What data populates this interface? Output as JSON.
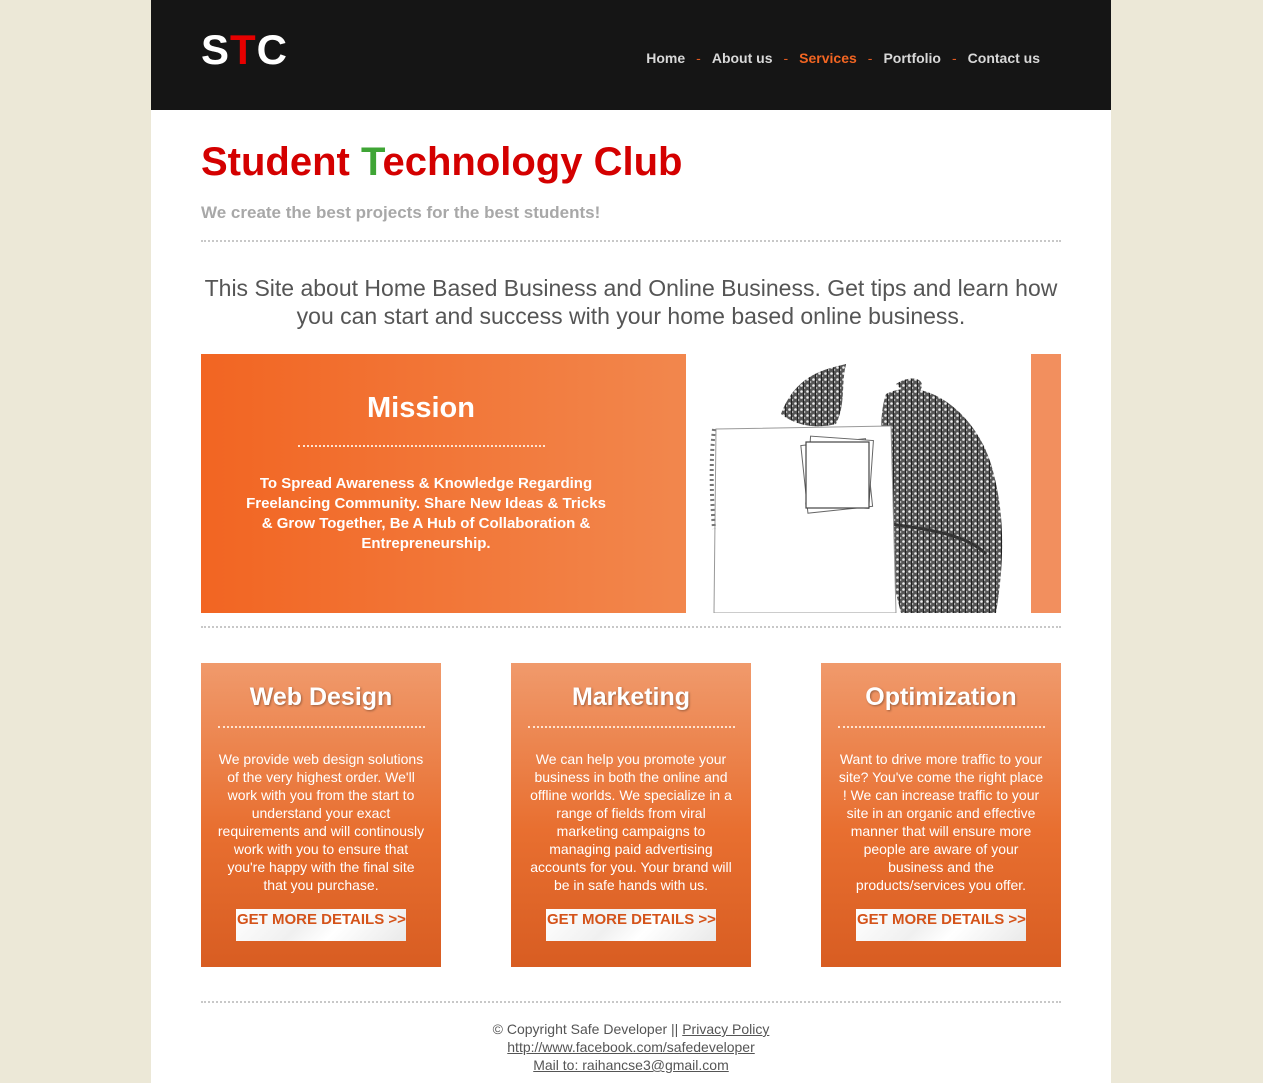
{
  "header": {
    "logo": [
      "S",
      "T",
      "C"
    ],
    "nav": [
      {
        "label": "Home",
        "active": false
      },
      {
        "label": "About us",
        "active": false
      },
      {
        "label": "Services",
        "active": true
      },
      {
        "label": "Portfolio",
        "active": false
      },
      {
        "label": "Contact us",
        "active": false
      }
    ],
    "nav_separator": "-"
  },
  "hero": {
    "title_before": "Student ",
    "title_highlight": "T",
    "title_after": "echnology Club",
    "tagline": "We create the best projects for the best students!",
    "intro": "This Site about Home Based Business and Online Business. Get tips and learn how you can start and success with your home based online business."
  },
  "mission": {
    "heading": "Mission",
    "text": "To Spread Awareness & Knowledge Regarding Freelancing Community. Share New Ideas & Tricks & Grow Together, Be A Hub of Collaboration & Entrepreneurship."
  },
  "services": [
    {
      "title": "Web Design",
      "text": "We provide web design solutions of the very highest order. We'll work with you from the start to understand your exact requirements and will continously work with you to ensure that you're happy with the final site that you purchase.",
      "button": "GET MORE DETAILS >>"
    },
    {
      "title": "Marketing",
      "text": "We can help you promote your business in both the online and offline worlds. We specialize in a range of fields from viral marketing campaigns to managing paid advertising accounts for you. Your brand will be in safe hands with us.",
      "button": "GET MORE DETAILS >>"
    },
    {
      "title": "Optimization",
      "text": "Want to drive more traffic to your site? You've come the right place ! We can increase traffic to your site in an organic and effective manner that will ensure more people are aware of your business and the products/services you offer.",
      "button": "GET MORE DETAILS >>"
    }
  ],
  "footer": {
    "copyright": "© Copyright Safe Developer || ",
    "privacy": "Privacy Policy",
    "facebook": "http://www.facebook.com/safedeveloper",
    "mail": "Mail to: raihancse3@gmail.com"
  },
  "colors": {
    "accent": "#f26522",
    "title_red": "#d40000",
    "title_green": "#3fa535",
    "header_bg": "#151515",
    "page_bg": "#ece8d7"
  }
}
